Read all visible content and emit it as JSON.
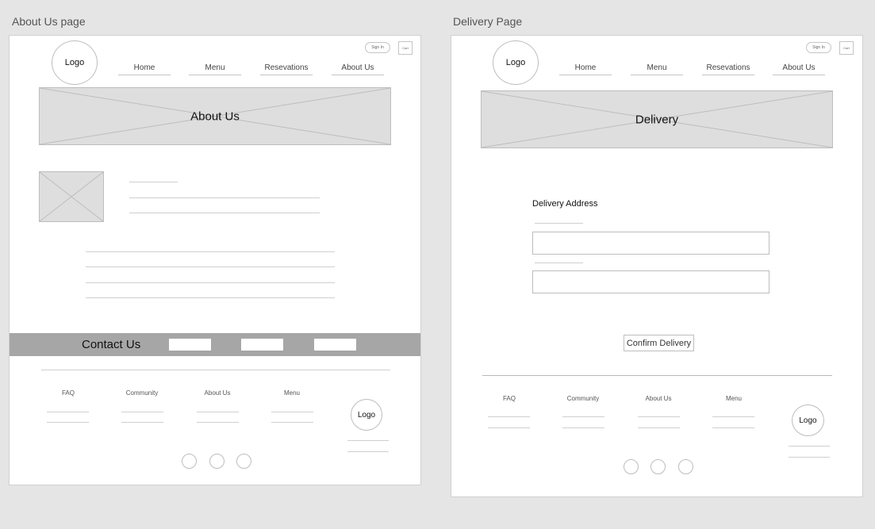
{
  "about_frame": {
    "label": "About Us page",
    "logo": "Logo",
    "sign_in": "Sign In",
    "cart": "Cart",
    "nav": [
      "Home",
      "Menu",
      "Resevations",
      "About Us"
    ],
    "hero_title": "About Us",
    "contact_title": "Contact Us",
    "footer_cols": [
      "FAQ",
      "Community",
      "About Us",
      "Menu"
    ],
    "footer_logo": "Logo"
  },
  "delivery_frame": {
    "label": "Delivery Page",
    "logo": "Logo",
    "sign_in": "Sign In",
    "cart": "Cart",
    "nav": [
      "Home",
      "Menu",
      "Resevations",
      "About Us"
    ],
    "hero_title": "Delivery",
    "address_label": "Delivery Address",
    "confirm_button": "Confirm Delivery",
    "footer_cols": [
      "FAQ",
      "Community",
      "About Us",
      "Menu"
    ],
    "footer_logo": "Logo"
  }
}
